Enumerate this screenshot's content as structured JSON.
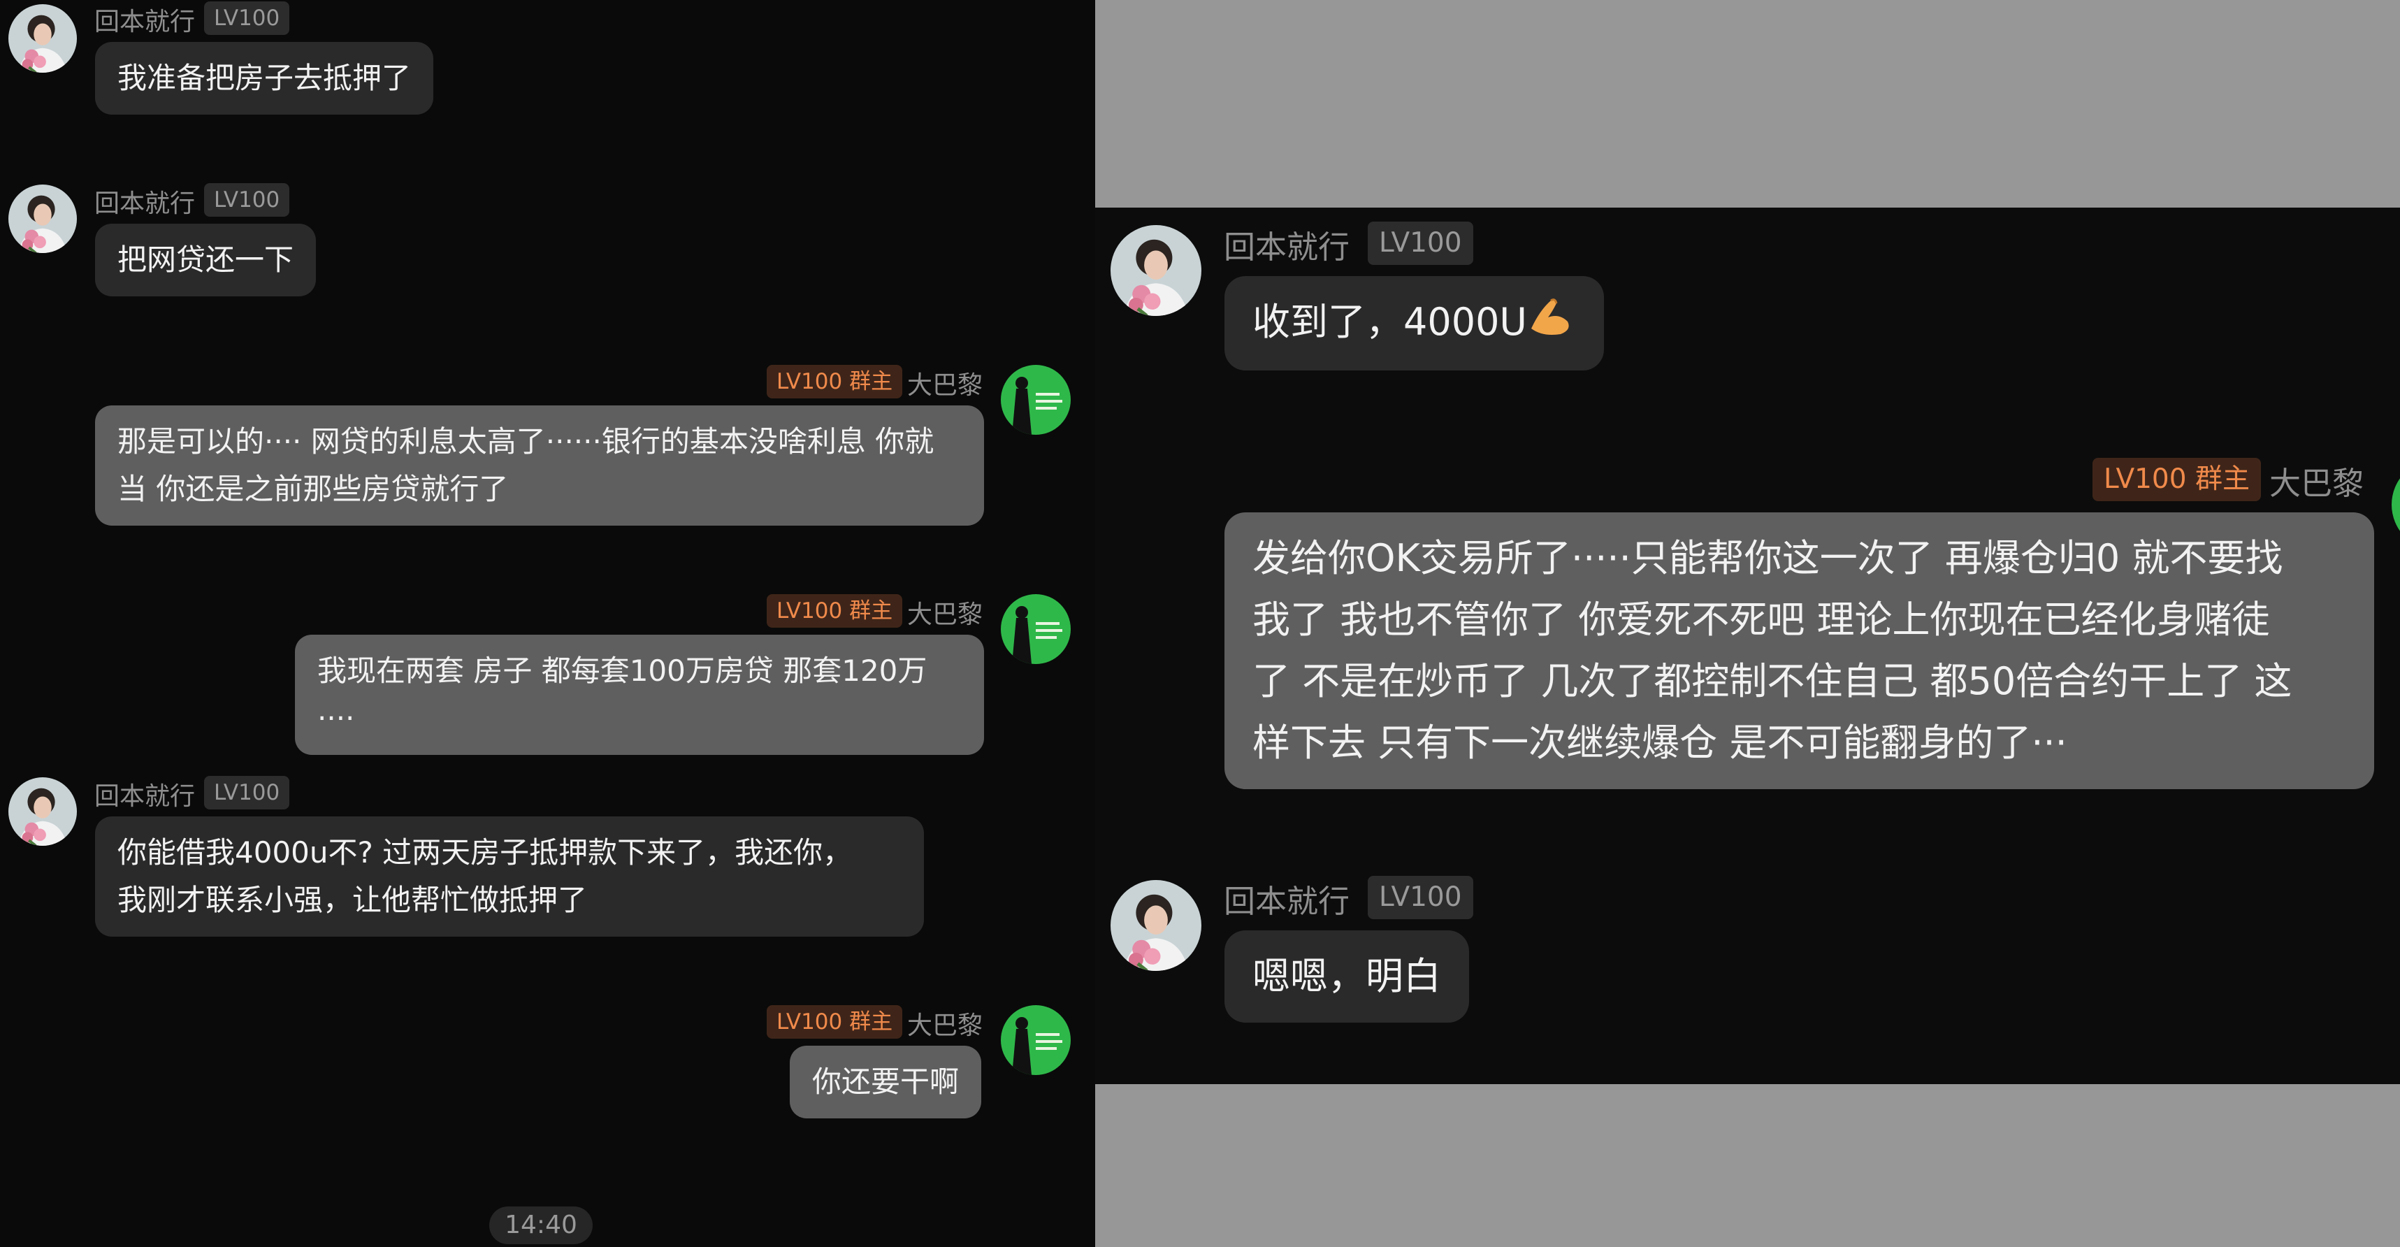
{
  "users": {
    "member": {
      "name": "回本就行",
      "level": "LV100",
      "avatar_icon": "woman-with-flowers-avatar"
    },
    "owner": {
      "name": "大巴黎",
      "level_badge": "LV100 群主",
      "avatar_icon": "green-portrait-avatar"
    }
  },
  "left_messages": [
    {
      "sender": "member",
      "text": "我准备把房子去抵押了"
    },
    {
      "sender": "member",
      "text": "把网贷还一下"
    },
    {
      "sender": "owner",
      "lines": [
        "那是可以的···· 网贷的利息太高了······银行的基本没啥利息 你就",
        "当 你还是之前那些房贷就行了"
      ]
    },
    {
      "sender": "owner",
      "text": "我现在两套 房子 都每套100万房贷 那套120万····"
    },
    {
      "sender": "member",
      "lines": [
        "你能借我4000u不? 过两天房子抵押款下来了，我还你，",
        "我刚才联系小强，让他帮忙做抵押了"
      ]
    },
    {
      "sender": "owner",
      "text": "你还要干啊"
    }
  ],
  "timestamp": "14:40",
  "right_messages": [
    {
      "sender": "member",
      "text": "收到了，4000U",
      "emoji_icon": "ok-hand-emoji"
    },
    {
      "sender": "owner",
      "lines": [
        "发给你OK交易所了·····只能帮你这一次了 再爆仓归0 就不要找",
        "我了 我也不管你了 你爱死不死吧  理论上你现在已经化身赌徒",
        "了 不是在炒币了 几次了都控制不住自己 都50倍合约干上了 这",
        "样下去 只有下一次继续爆仓 是不可能翻身的了···"
      ]
    },
    {
      "sender": "member",
      "text": "嗯嗯，明白"
    }
  ],
  "colors": {
    "background": "#0a0a0a",
    "incoming_bubble": "#2a2a2a",
    "outgoing_bubble": "#5f5f5f",
    "owner_badge_text": "#f08a4b",
    "owner_badge_bg": "#3f2519",
    "gray_filler": "#979797"
  }
}
